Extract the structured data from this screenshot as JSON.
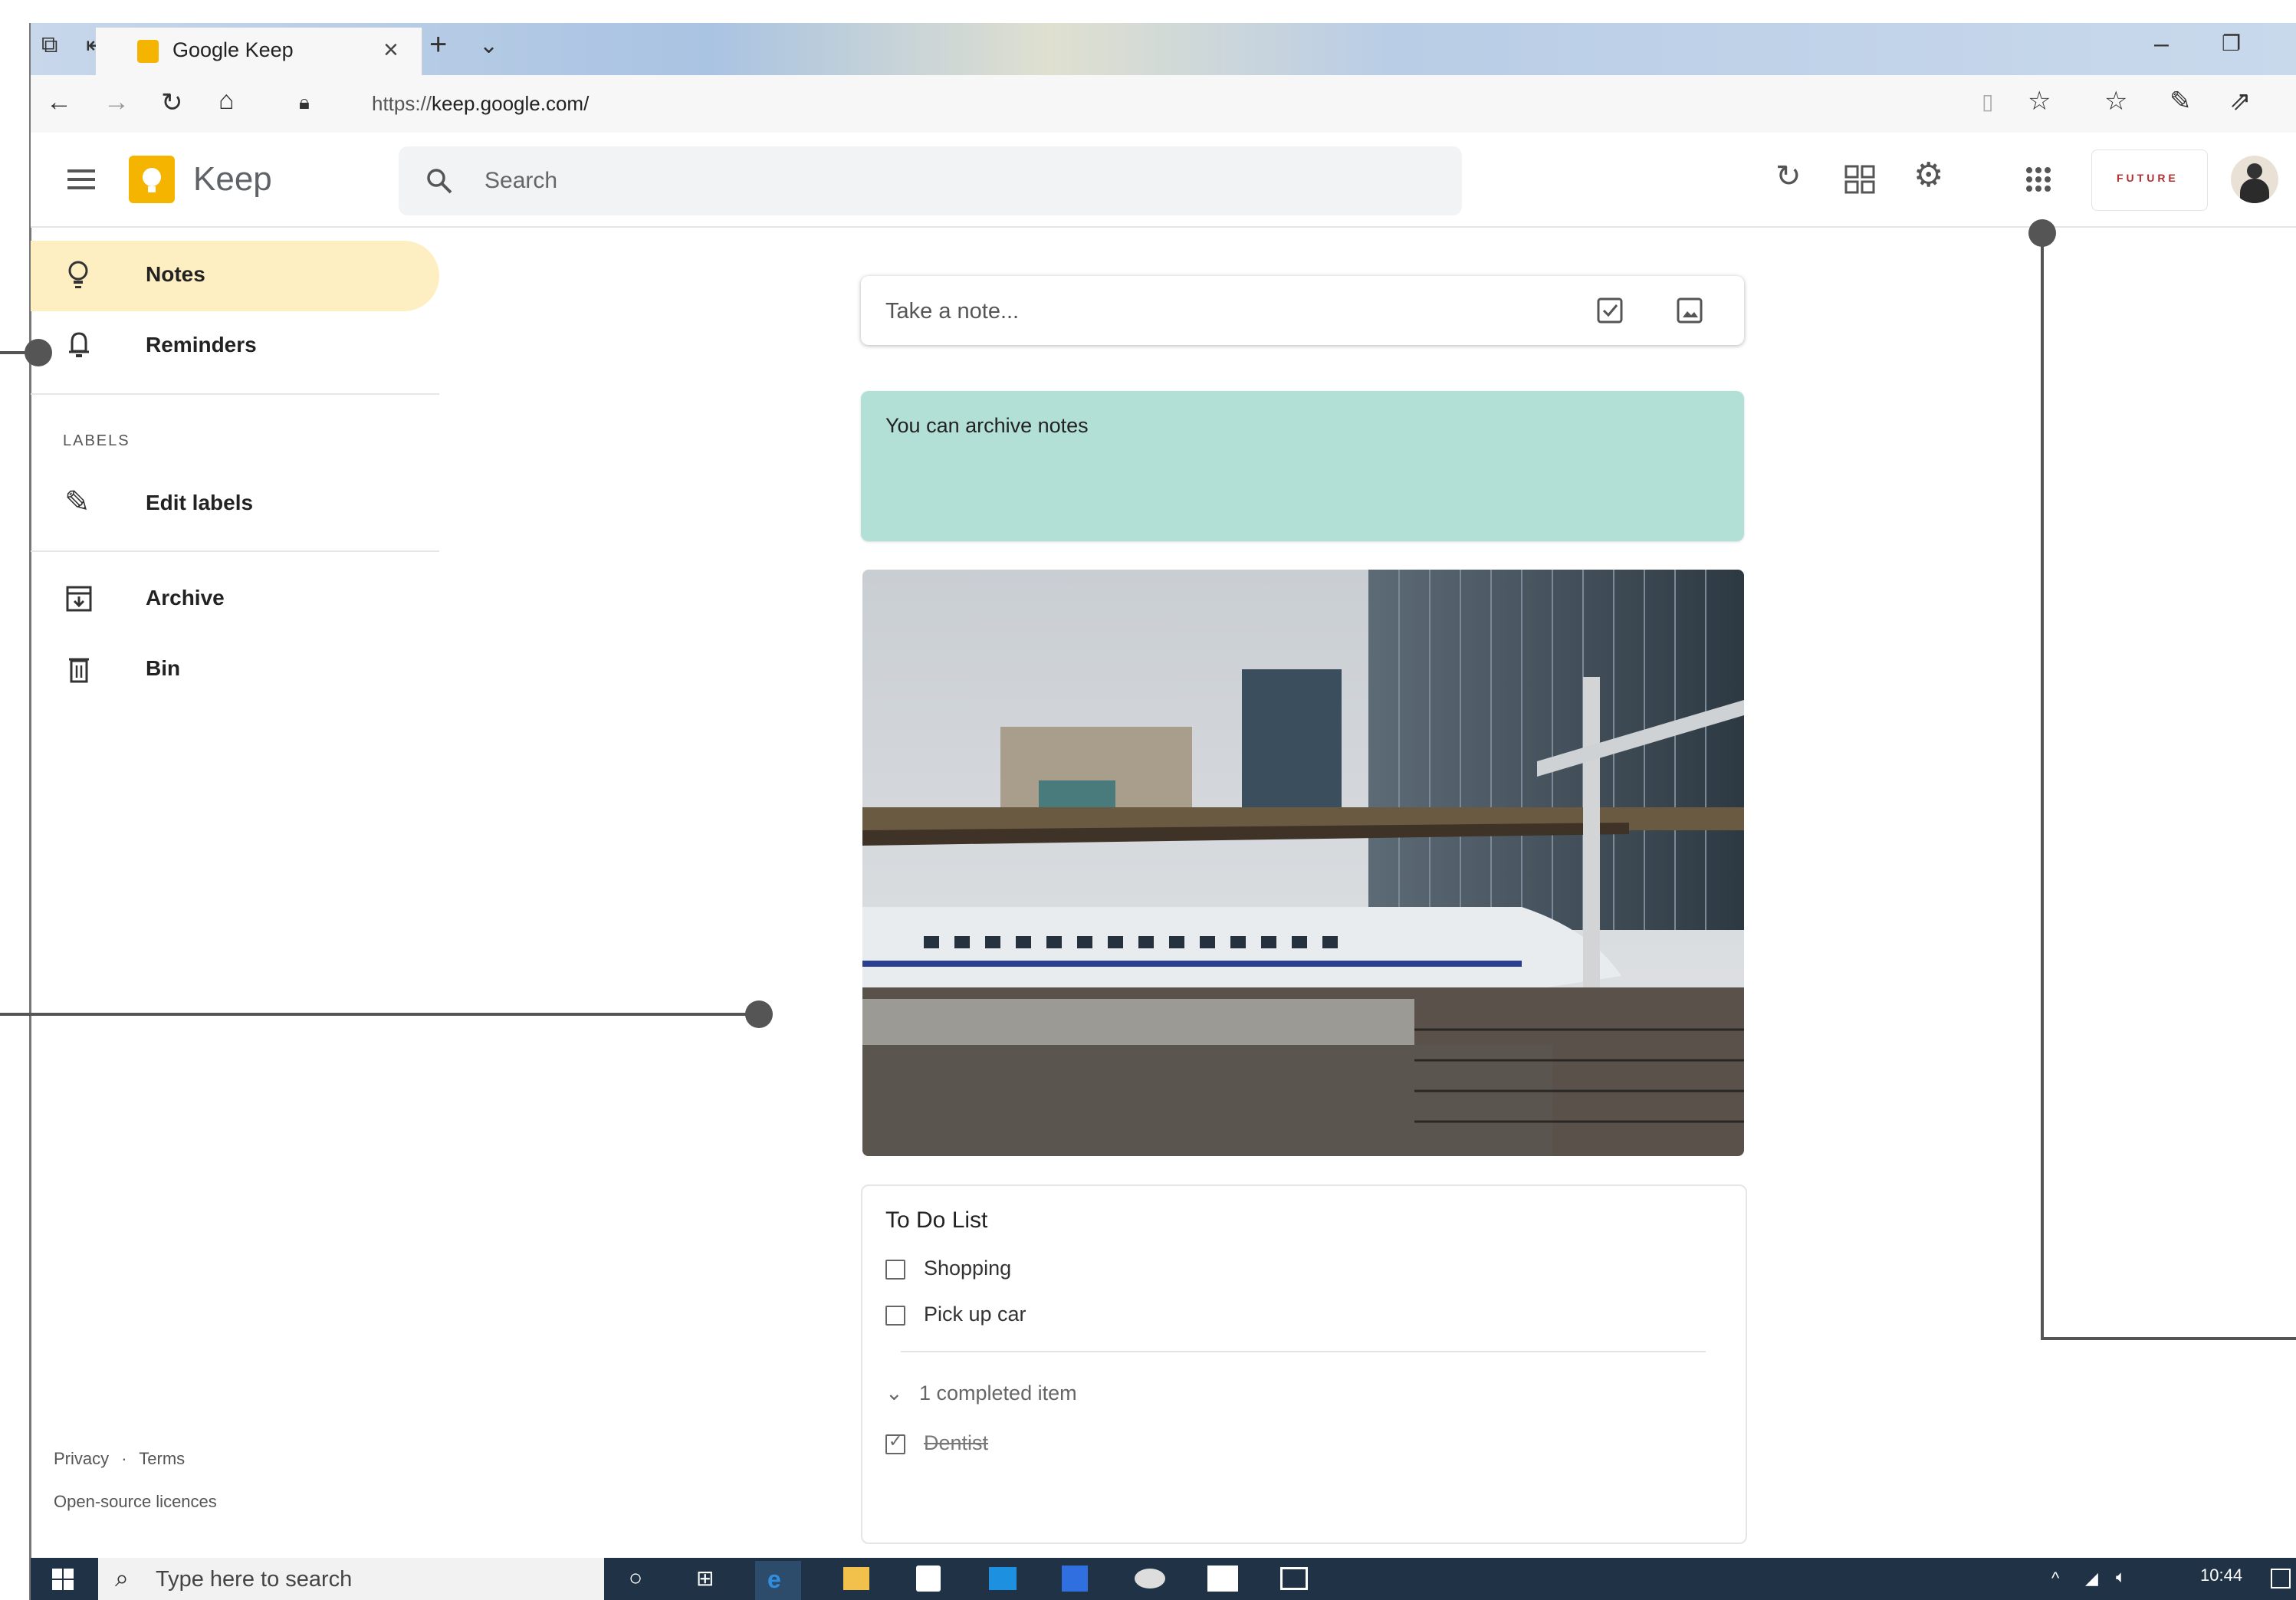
{
  "browser": {
    "tab_title": "Google Keep",
    "url_prefix": "https://",
    "url_host": "keep.google.com/"
  },
  "header": {
    "app_name": "Keep",
    "search_placeholder": "Search",
    "brand_badge": "FUTURE"
  },
  "sidebar": {
    "items": [
      {
        "label": "Notes",
        "icon": "lightbulb-icon",
        "active": true
      },
      {
        "label": "Reminders",
        "icon": "bell-icon"
      }
    ],
    "labels_heading": "LABELS",
    "edit_labels": "Edit labels",
    "archive": "Archive",
    "bin": "Bin",
    "footer": {
      "privacy": "Privacy",
      "separator": "·",
      "terms": "Terms",
      "licences": "Open-source licences"
    }
  },
  "notes": {
    "take_note_placeholder": "Take a note...",
    "archive_note_text": "You can archive notes",
    "archive_note_color": "#b3e0d6",
    "todo": {
      "title": "To Do List",
      "items": [
        "Shopping",
        "Pick up car"
      ],
      "completed_toggle": "1 completed item",
      "completed_items": [
        "Dentist"
      ]
    }
  },
  "taskbar": {
    "search_placeholder": "Type here to search",
    "time": "10:44"
  },
  "colors": {
    "accent": "#feefc3",
    "taskbar": "#1f3246",
    "keep_logo": "#f4b400"
  }
}
